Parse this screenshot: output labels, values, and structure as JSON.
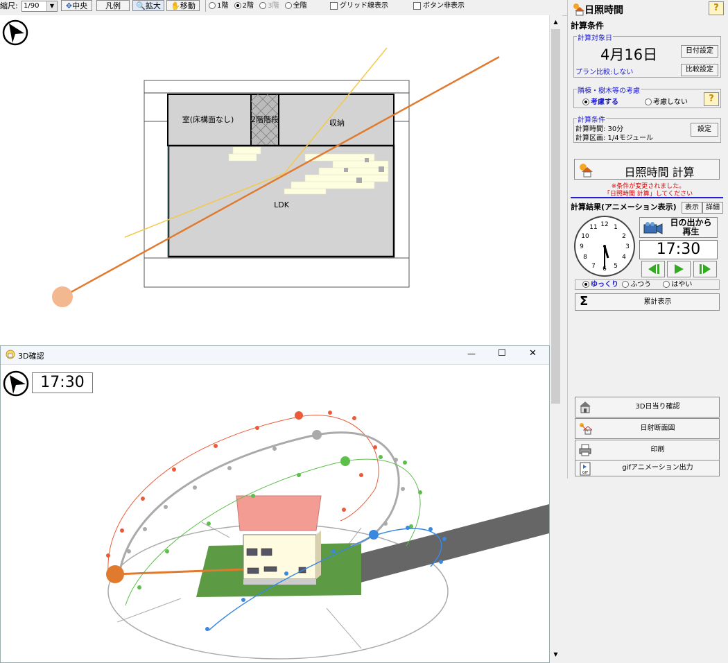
{
  "toolbar": {
    "scale_label": "縮尺:",
    "scale_value": "1/90",
    "center_button": "中央",
    "legend_button": "凡例",
    "zoom_button": "拡大",
    "move_button": "移動",
    "floor_options": [
      "1階",
      "2階",
      "3階",
      "全階"
    ],
    "floor_selected": "2階",
    "grid_checkbox": "グリッド線表示",
    "hide_buttons_checkbox": "ボタン非表示"
  },
  "plan": {
    "rooms": [
      "室(床構面なし)",
      "2階階段",
      "収納",
      "LDK"
    ]
  },
  "window3d": {
    "title": "3D確認",
    "time": "17:30",
    "minimize": "—",
    "maximize": "☐",
    "close": "✕"
  },
  "panel": {
    "title": "日照時間",
    "help": "?",
    "conditions_header": "計算条件",
    "date_group_title": "計算対象日",
    "date_value": "4月16日",
    "date_button": "日付設定",
    "plan_compare": "プラン比較:しない",
    "compare_button": "比較設定",
    "neighbor_group_title": "隣棟・樹木等の考慮",
    "neighbor_options": [
      "考慮する",
      "考慮しない"
    ],
    "neighbor_selected": "考慮する",
    "calc_group_title": "計算条件",
    "calc_time": "計算時間:  30分",
    "calc_area": "計算区画:  1/4モジュール",
    "settings_button": "設定",
    "calc_button": "日照時間 計算",
    "warning_line1": "※条件が変更されました。",
    "warning_line2": "「日照時間 計算」してください",
    "results_header": "計算結果(アニメーション表示)",
    "display_button": "表示",
    "detail_button": "詳細",
    "play_button_line1": "日の出から",
    "play_button_line2": "再生",
    "time_display": "17:30",
    "speed_options": [
      "ゆっくり",
      "ふつう",
      "はやい"
    ],
    "speed_selected": "ゆっくり",
    "cumulative_button": "累計表示",
    "clock_numbers": [
      "12",
      "1",
      "2",
      "3",
      "4",
      "5",
      "6",
      "7",
      "8",
      "9",
      "10",
      "11"
    ],
    "bottom_buttons": [
      "3D日当り確認",
      "日射断面図",
      "印刷",
      "gifアニメーション出力"
    ]
  },
  "icons": {
    "compass": "north-arrow-icon",
    "sun_house": "sun-house-icon",
    "camera": "video-camera-icon",
    "sigma": "sigma-icon",
    "printer": "printer-icon",
    "gif": "gif-file-icon"
  },
  "colors": {
    "sun_path_orange": "#e07a2e",
    "sun_path_yellow": "#f3c94a",
    "sun_circle": "#f3b88f",
    "play_green": "#33aa22",
    "plan_gray": "#d3d3d3",
    "sunny_cells": "#fdfde0",
    "lawn_green": "#5c9a44",
    "roof_pink": "#f29c94"
  }
}
